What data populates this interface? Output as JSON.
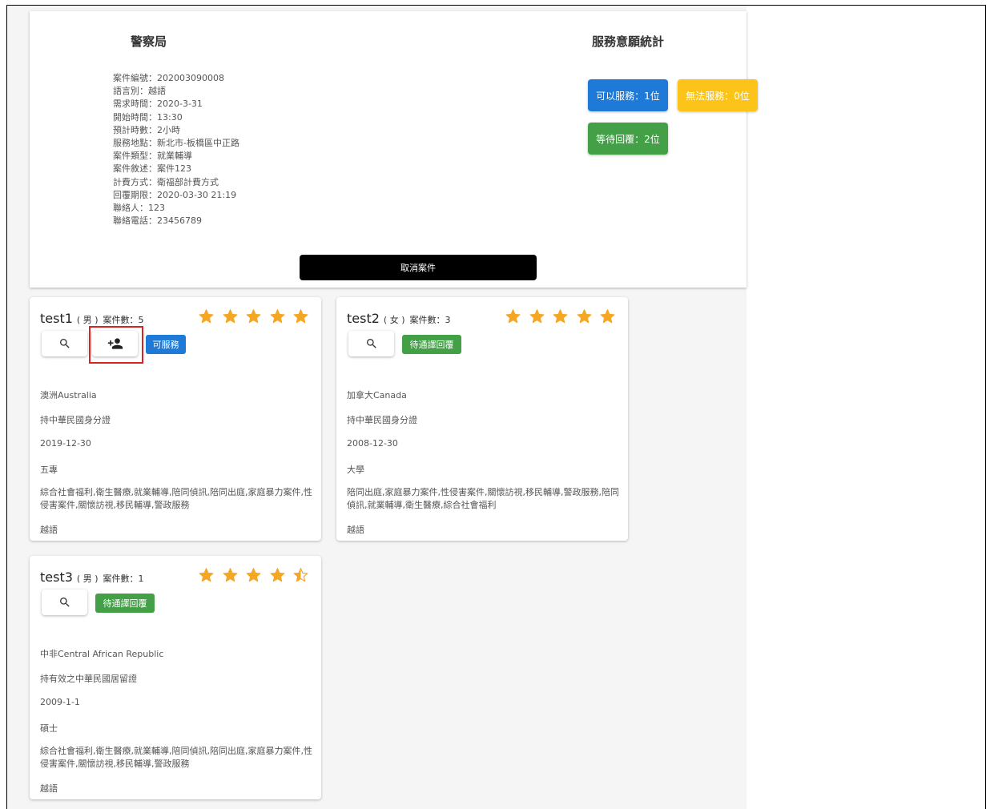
{
  "agency": {
    "title": "警察局"
  },
  "case_info": [
    "案件編號：202003090008",
    "語言別：越語",
    "需求時間：2020-3-31",
    "開始時間：13:30",
    "預計時數：2小時",
    "服務地點：新北市-板橋區中正路",
    "案件類型：就業輔導",
    "案件敘述：案件123",
    "計費方式：衛福部計費方式",
    "回覆期限：2020-03-30 21:19",
    "聯絡人：123",
    "聯絡電話：23456789"
  ],
  "stats": {
    "title": "服務意願統計",
    "available_label": "可以服務：1位",
    "unavailable_label": "無法服務：0位",
    "waiting_label": "等待回覆：2位",
    "colors": {
      "available": "#1e7ad6",
      "unavailable": "#fcc419",
      "waiting": "#43a047"
    }
  },
  "actions": {
    "cancel_label": "取消案件"
  },
  "interpreters": [
    {
      "name": "test1",
      "gender": "( 男 )",
      "case_count": "案件數：5",
      "rating": 5,
      "status": "可服務",
      "status_color": "#1e7ad6",
      "country": "澳洲Australia",
      "id_type": "持中華民國身分證",
      "date": "2019-12-30",
      "education": "五專",
      "services": "綜合社會福利,衛生醫療,就業輔導,陪同偵訊,陪同出庭,家庭暴力案件,性侵害案件,關懷訪視,移民輔導,警政服務",
      "language": "越語"
    },
    {
      "name": "test2",
      "gender": "( 女 )",
      "case_count": "案件數：3",
      "rating": 5,
      "status": "待通譯回覆",
      "status_color": "#43a047",
      "country": "加拿大Canada",
      "id_type": "持中華民國身分證",
      "date": "2008-12-30",
      "education": "大學",
      "services": "陪同出庭,家庭暴力案件,性侵害案件,關懷訪視,移民輔導,警政服務,陪同偵訊,就業輔導,衛生醫療,綜合社會福利",
      "language": "越語"
    },
    {
      "name": "test3",
      "gender": "( 男 )",
      "case_count": "案件數：1",
      "rating": 4.5,
      "status": "待通譯回覆",
      "status_color": "#43a047",
      "country": "中非Central African Republic",
      "id_type": "持有效之中華民國居留證",
      "date": "2009-1-1",
      "education": "碩士",
      "services": "綜合社會福利,衛生醫療,就業輔導,陪同偵訊,陪同出庭,家庭暴力案件,性侵害案件,關懷訪視,移民輔導,警政服務",
      "language": "越語"
    }
  ],
  "icons": {
    "search": "search-icon",
    "add_person": "person-add-icon",
    "star": "star-icon",
    "star_half": "star-half-icon"
  },
  "star_color": "#f5a623"
}
